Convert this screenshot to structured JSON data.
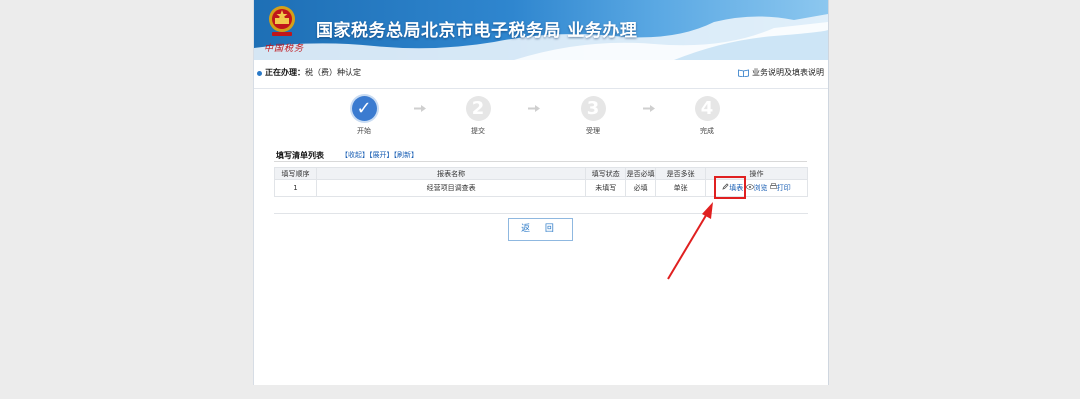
{
  "header": {
    "emblem_script": "中国税务",
    "title": "国家税务总局北京市电子税务局",
    "subtitle": "业务办理"
  },
  "infobar": {
    "doing_label": "正在办理：",
    "doing_value": "税（费）种认定",
    "help_link": "业务说明及填表说明"
  },
  "steps": [
    {
      "num": "✓",
      "label": "开始",
      "state": "done"
    },
    {
      "num": "2",
      "label": "提交",
      "state": "pending"
    },
    {
      "num": "3",
      "label": "受理",
      "state": "pending"
    },
    {
      "num": "4",
      "label": "完成",
      "state": "pending"
    }
  ],
  "list": {
    "title": "填写清单列表",
    "collapse": "【收起】",
    "expand": "【展开】",
    "refresh": "【刷新】",
    "columns": [
      "填写顺序",
      "报表名称",
      "填写状态",
      "是否必填",
      "是否多张",
      "操作"
    ],
    "rows": [
      {
        "seq": "1",
        "name": "经营项目调查表",
        "status": "未填写",
        "required": "必填",
        "multiple": "单张"
      }
    ],
    "ops": {
      "fill": "填表",
      "view": "浏览",
      "print": "打印"
    }
  },
  "back_button": "返 回",
  "colors": {
    "accent": "#2a79c7",
    "banner": "#1e6fb5",
    "highlight": "#e02020"
  }
}
